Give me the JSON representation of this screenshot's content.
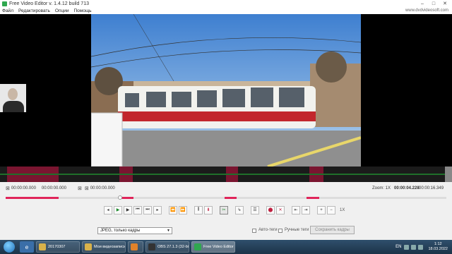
{
  "window": {
    "title": "Free Video Editor v. 1.4.12 build 713",
    "buttons": [
      "–",
      "□",
      "✕"
    ]
  },
  "menu": {
    "items": [
      "Файл",
      "Редактировать",
      "Опции",
      "Помощь"
    ],
    "site": "www.dvdvideosoft.com"
  },
  "timeline": {
    "segments": [
      {
        "start": 0.015,
        "end": 0.13
      },
      {
        "start": 0.264,
        "end": 0.293
      },
      {
        "start": 0.5,
        "end": 0.527
      },
      {
        "start": 0.684,
        "end": 0.716
      }
    ]
  },
  "info": {
    "mark_in": "00:00:00.000",
    "mark_out": "00:00:00.000",
    "mark_cut": "00:00:00.000",
    "zoom_label": "Zoom: 1X",
    "position": "00:00:04.228",
    "duration": "00:00:16.349"
  },
  "scrub": {
    "position_fraction": 0.259,
    "segments": [
      {
        "start": 0.0,
        "end": 0.12
      },
      {
        "start": 0.262,
        "end": 0.29
      },
      {
        "start": 0.497,
        "end": 0.524
      },
      {
        "start": 0.682,
        "end": 0.712
      }
    ]
  },
  "controls": {
    "zoom_value": "1X"
  },
  "footer": {
    "format": "JPEG, только кадры",
    "auto_tags": "Авто-теги",
    "manual_tags": "Ручные теги",
    "save_frames": "Сохранить кадры"
  },
  "taskbar": {
    "tasks": [
      {
        "label": "20170307",
        "color": "#d9b24a",
        "active": false
      },
      {
        "label": "Мои видеозаписи",
        "color": "#d9b24a",
        "active": false
      },
      {
        "label": "",
        "color": "#e0822a",
        "active": false
      },
      {
        "label": "OBS 27.1.3 (32-bit...",
        "color": "#333333",
        "active": false
      },
      {
        "label": "Free Video Editor",
        "color": "#2fa84f",
        "active": true
      }
    ],
    "lang": "EN",
    "time": "1:12",
    "date": "18.03.2022"
  }
}
